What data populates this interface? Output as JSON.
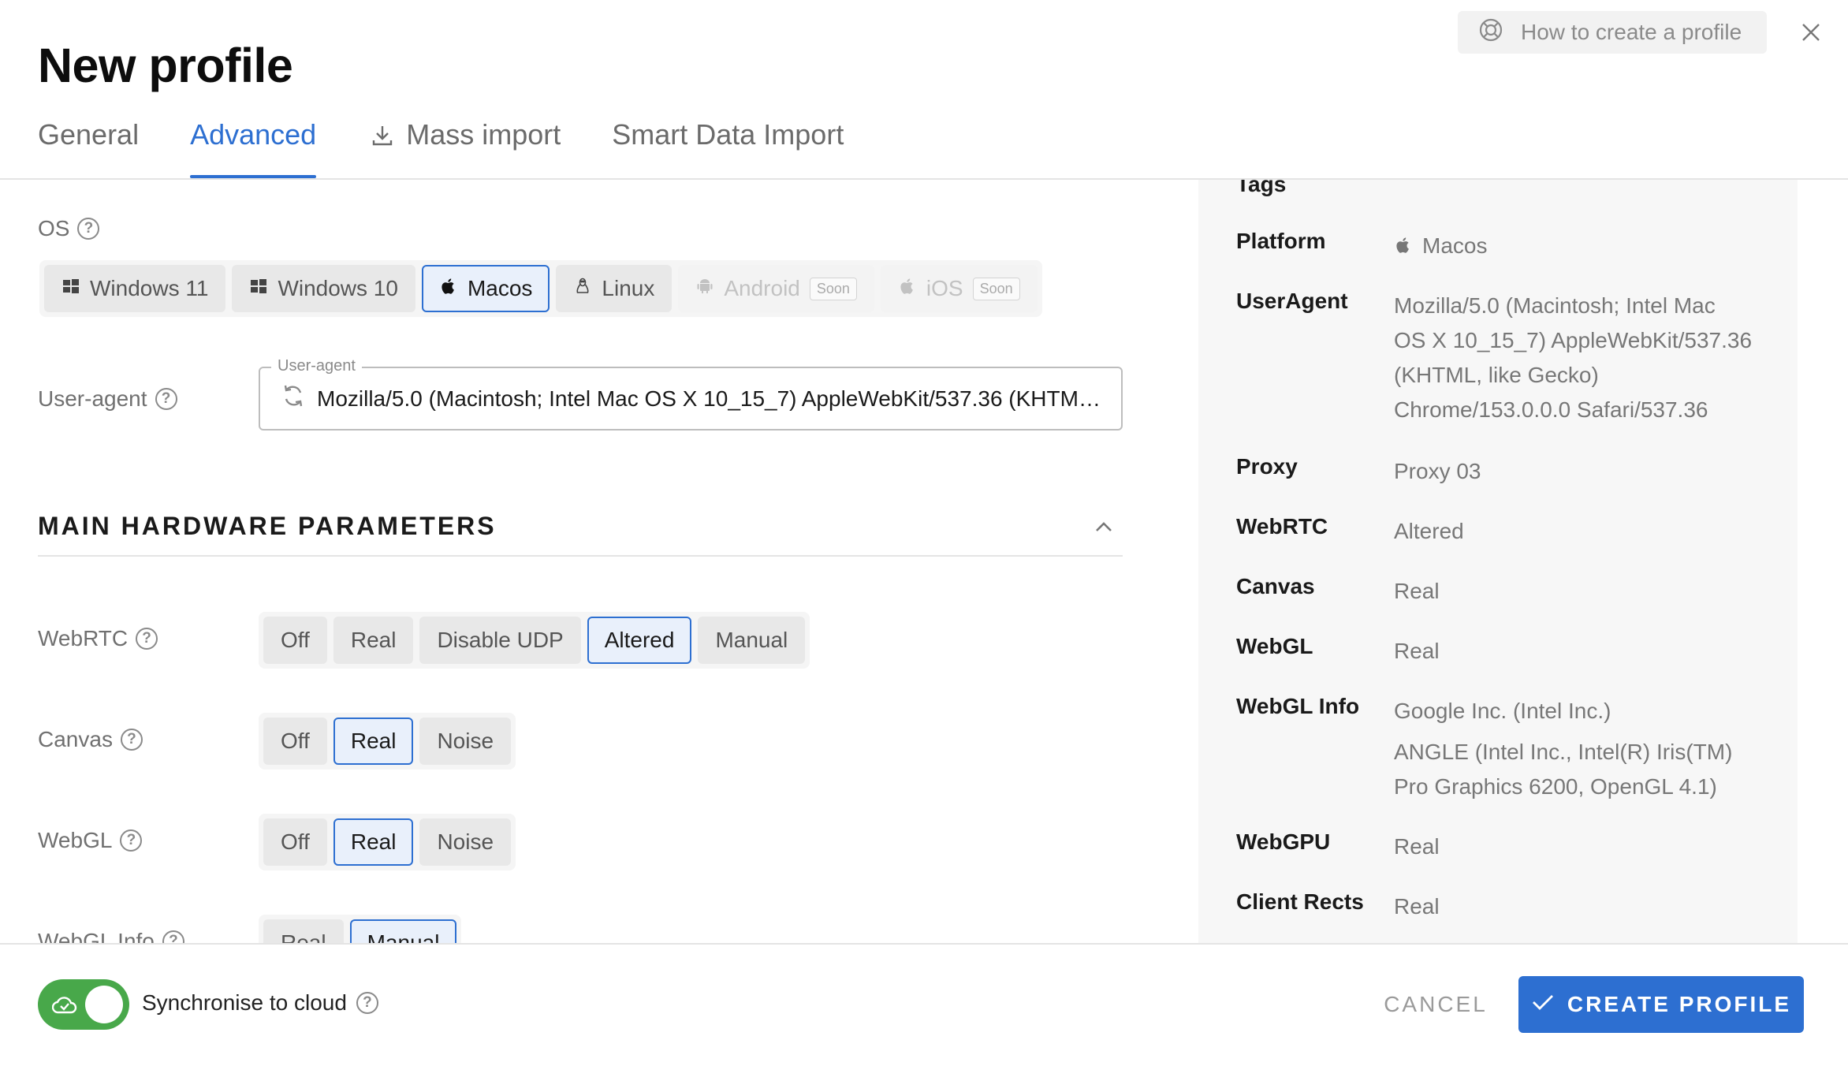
{
  "header": {
    "title": "New profile",
    "help_link": "How to create a profile",
    "tabs": [
      "General",
      "Advanced",
      "Mass import",
      "Smart Data Import"
    ]
  },
  "os": {
    "label": "OS",
    "options": [
      "Windows 11",
      "Windows 10",
      "Macos",
      "Linux",
      "Android",
      "iOS"
    ],
    "soon": "Soon",
    "selected": "Macos"
  },
  "user_agent": {
    "label": "User-agent",
    "legend": "User-agent",
    "value": "Mozilla/5.0 (Macintosh; Intel Mac OS X 10_15_7) AppleWebKit/537.36 (KHTML, like Gecko) Chrome/153.0.0.0 Safari/537.36"
  },
  "hardware": {
    "section_title": "MAIN HARDWARE PARAMETERS",
    "webrtc": {
      "label": "WebRTC",
      "options": [
        "Off",
        "Real",
        "Disable UDP",
        "Altered",
        "Manual"
      ],
      "selected": "Altered"
    },
    "canvas": {
      "label": "Canvas",
      "options": [
        "Off",
        "Real",
        "Noise"
      ],
      "selected": "Real"
    },
    "webgl": {
      "label": "WebGL",
      "options": [
        "Off",
        "Real",
        "Noise"
      ],
      "selected": "Real"
    },
    "webgl_info": {
      "label": "WebGL Info",
      "options": [
        "Real",
        "Manual"
      ],
      "selected": "Manual"
    }
  },
  "summary": {
    "tags": "Tags",
    "platform": {
      "key": "Platform",
      "value": "Macos"
    },
    "useragent": {
      "key": "UserAgent",
      "lines": [
        "Mozilla/5.0 (Macintosh; Intel Mac",
        "OS X 10_15_7) AppleWebKit/537.36",
        "(KHTML, like Gecko)",
        "Chrome/153.0.0.0 Safari/537.36"
      ]
    },
    "proxy": {
      "key": "Proxy",
      "value": "Proxy 03"
    },
    "webrtc": {
      "key": "WebRTC",
      "value": "Altered"
    },
    "canvas": {
      "key": "Canvas",
      "value": "Real"
    },
    "webgl": {
      "key": "WebGL",
      "value": "Real"
    },
    "webgl_info": {
      "key": "WebGL Info",
      "lines": [
        "Google Inc. (Intel Inc.)",
        "ANGLE (Intel Inc., Intel(R) Iris(TM)",
        "Pro Graphics 6200, OpenGL 4.1)"
      ]
    },
    "webgpu": {
      "key": "WebGPU",
      "value": "Real"
    },
    "client_rects": {
      "key": "Client Rects",
      "value": "Real"
    }
  },
  "footer": {
    "sync_label": "Synchronise to cloud",
    "sync_enabled": true,
    "cancel": "CANCEL",
    "create": "CREATE PROFILE"
  },
  "colors": {
    "accent": "#2d6fd1",
    "toggle_on": "#48a84a",
    "selected_bg": "#e9f0fb"
  }
}
